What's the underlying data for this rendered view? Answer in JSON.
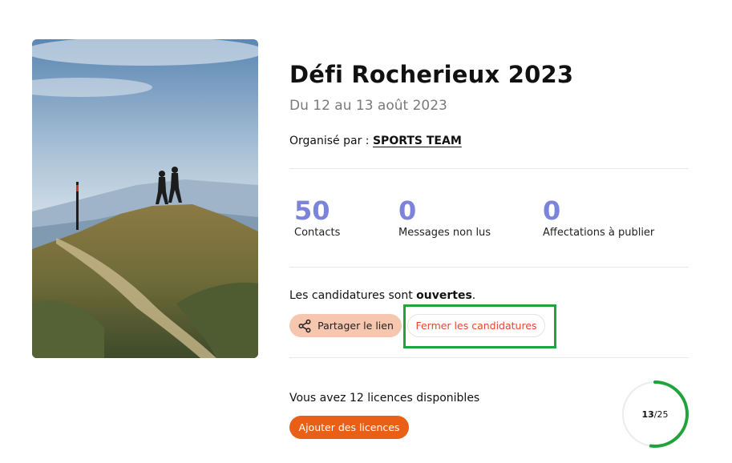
{
  "event": {
    "title": "Défi Rocherieux 2023",
    "dates": "Du 12 au 13 août 2023",
    "organizer_prefix": "Organisé par :",
    "organizer_name": "SPORTS TEAM"
  },
  "stats": [
    {
      "value": "50",
      "label": "Contacts"
    },
    {
      "value": "0",
      "label": "Messages non lus"
    },
    {
      "value": "0",
      "label": "Affectations à publier"
    }
  ],
  "applications": {
    "prefix": "Les candidatures sont",
    "state": "ouvertes",
    "suffix": ".",
    "share_label": "Partager le lien",
    "close_label": "Fermer les candidatures"
  },
  "licences": {
    "prefix": "Vous avez",
    "count": "12",
    "suffix": "licences disponibles",
    "add_label": "Ajouter des licences",
    "used": "13",
    "total": "25",
    "used_fraction": 0.52,
    "ring_color": "#1fa33a"
  },
  "colors": {
    "accent_stats": "#7b83db",
    "share_bg": "#f6c6ae",
    "add_bg": "#e85f15",
    "close_text": "#e04a2f",
    "highlight": "#1fa33a"
  },
  "icons": {
    "share": "share-icon"
  }
}
